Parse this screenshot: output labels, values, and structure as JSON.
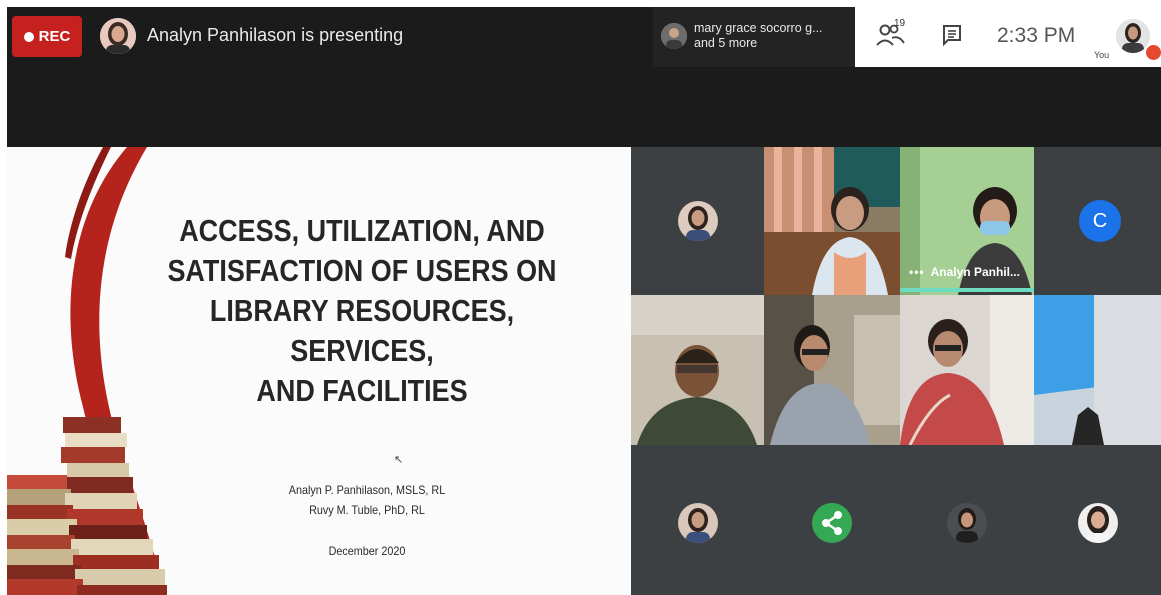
{
  "topbar": {
    "rec_label": "REC",
    "presenting_text": "Analyn Panhilason is presenting",
    "notification": {
      "line1": "mary grace socorro g...",
      "line2": "and 5 more"
    },
    "participants_count": "19",
    "clock": "2:33 PM",
    "you_label": "You"
  },
  "slide": {
    "title_lines": [
      "ACCESS, UTILIZATION, AND",
      "SATISFACTION OF USERS ON",
      "LIBRARY RESOURCES, SERVICES,",
      "AND FACILITIES"
    ],
    "author1": "Analyn P. Panhilason, MSLS, RL",
    "author2": "Ruvy M. Tuble, PhD, RL",
    "date": "December 2020"
  },
  "grid": {
    "c_avatar_letter": "C",
    "speaking_name": "Analyn Panhil..."
  },
  "colors": {
    "rec_red": "#c5221f",
    "meet_blue": "#1a73e8",
    "share_green": "#34a853",
    "speaking_highlight": "#6ddcc1",
    "ribbon_red": "#b5231d"
  },
  "icons": [
    "record-dot-icon",
    "people-icon",
    "chat-icon",
    "share-icon",
    "more-options-icon"
  ]
}
